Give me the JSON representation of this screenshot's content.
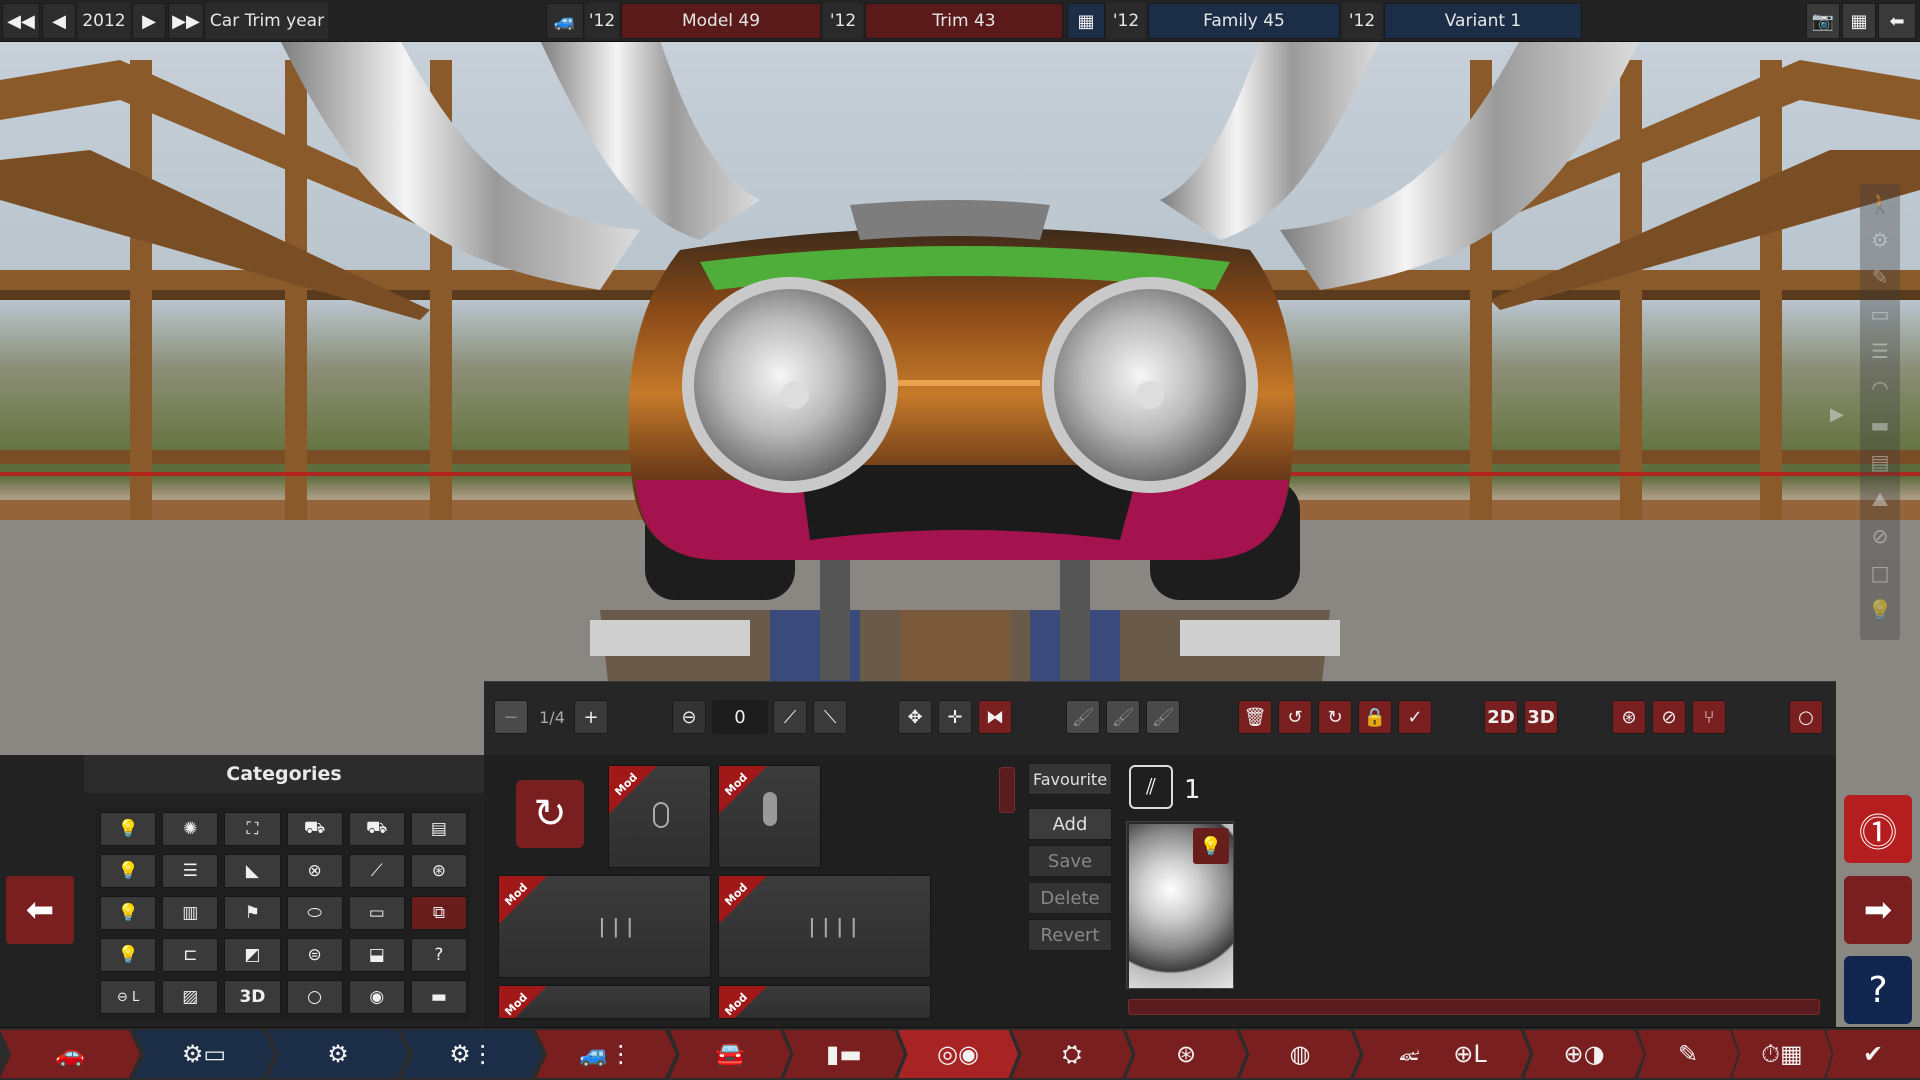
{
  "topbar": {
    "year_value": "2012",
    "trim_year_label": "Car Trim year",
    "model_year": "'12",
    "model_name": "Model 49",
    "trim_year": "'12",
    "trim_name": "Trim 43",
    "family_year": "'12",
    "family_name": "Family 45",
    "variant_year": "'12",
    "variant_name": "Variant 1"
  },
  "toolbar": {
    "page_indicator": "1/4",
    "rotation_value": "0",
    "view_2d": "2D",
    "view_3d": "3D"
  },
  "categories": {
    "title": "Categories",
    "label_3d": "3D",
    "label_ol": "⊖ L"
  },
  "parts": {
    "mod_label": "Mod",
    "favourite_label": "Favourite",
    "fixture_count": "1",
    "add_label": "Add",
    "save_label": "Save",
    "delete_label": "Delete",
    "revert_label": "Revert"
  },
  "icons": {
    "accent": "#8b1e1e",
    "blue": "#1b2d47"
  }
}
